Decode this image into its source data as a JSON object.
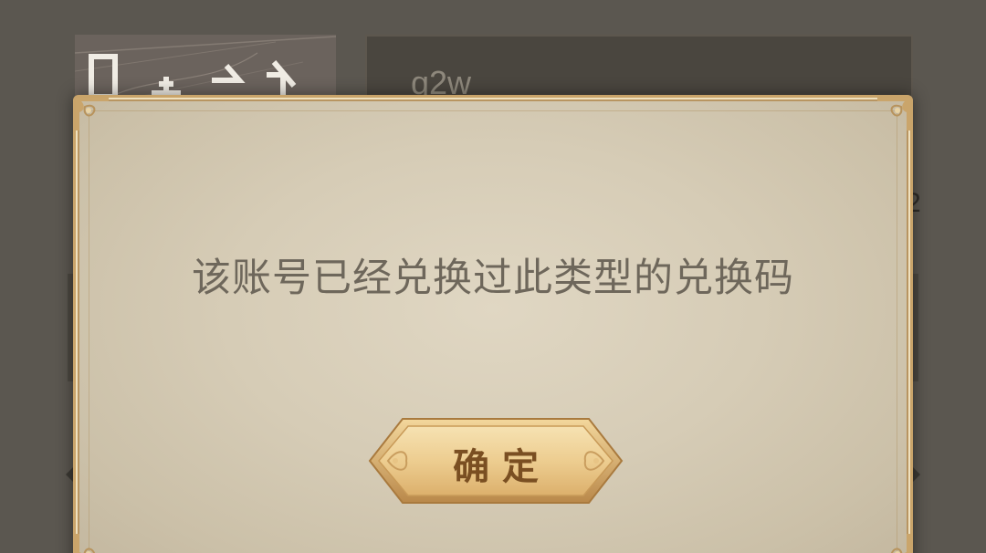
{
  "background": {
    "code_field_value": "q2w",
    "right_edge_glyph": "2"
  },
  "dialog": {
    "message": "该账号已经兑换过此类型的兑换码",
    "confirm_label": "确定"
  },
  "colors": {
    "dialog_bg": "#d9cfb9",
    "dialog_border": "#c9a46a",
    "message_text": "#6e675b",
    "button_gold": "#e8c485",
    "button_text": "#7a4f22",
    "overlay": "#5b5750"
  },
  "icons": {
    "corner_ornament": "corner-ornament-icon",
    "button_side_ornament": "flourish-icon"
  }
}
